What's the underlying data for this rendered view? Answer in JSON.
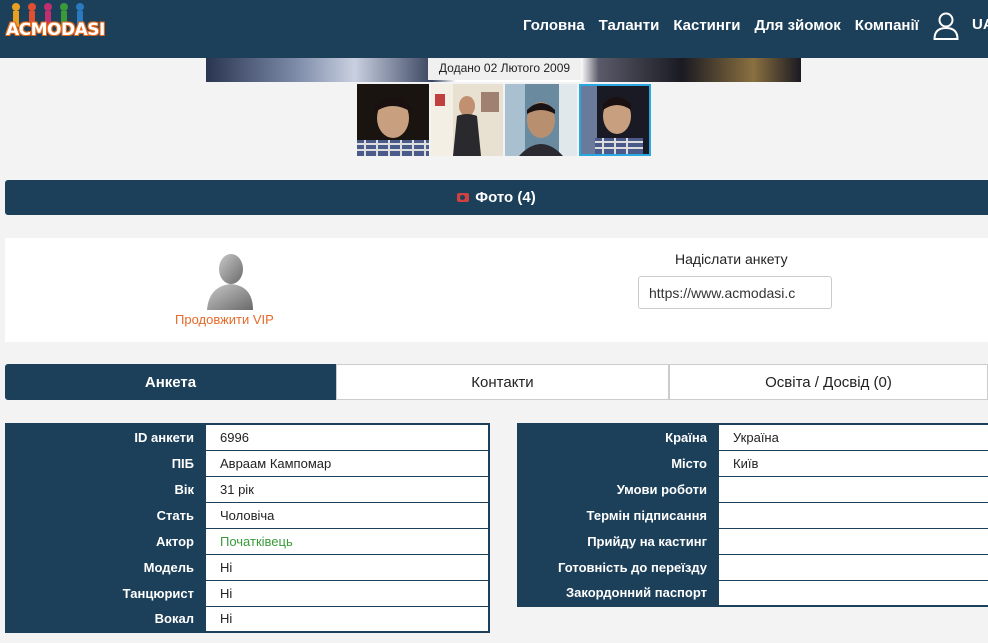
{
  "header": {
    "logo_text": "ACMODASI",
    "nav": [
      "Головна",
      "Таланти",
      "Кастинги",
      "Для зйомок",
      "Компанії"
    ],
    "lang": "UA"
  },
  "photo": {
    "caption": "Додано 02 Лютого 2009",
    "thumbnail_count": 4,
    "active_index": 3
  },
  "photo_bar": {
    "label": "Фото (4)",
    "icon": "camera-icon"
  },
  "panel": {
    "vip_label": "Продовжити VIP",
    "send_title": "Надіслати анкету",
    "send_value": "https://www.acmodasi.c"
  },
  "tabs": [
    {
      "label": "Анкета",
      "active": true
    },
    {
      "label": "Контакти",
      "active": false
    },
    {
      "label": "Освіта / Досвід (0)",
      "active": false
    }
  ],
  "left_table": [
    {
      "k": "ID анкети",
      "v": "6996"
    },
    {
      "k": "ПІБ",
      "v": "Авраам Кампомар"
    },
    {
      "k": "Вік",
      "v": "31 рік"
    },
    {
      "k": "Стать",
      "v": "Чоловіча"
    },
    {
      "k": "Актор",
      "v": "Початківець"
    },
    {
      "k": "Модель",
      "v": "Ні"
    },
    {
      "k": "Танцюрист",
      "v": "Ні"
    },
    {
      "k": "Вокал",
      "v": "Ні"
    }
  ],
  "right_table": [
    {
      "k": "Країна",
      "v": "Україна"
    },
    {
      "k": "Місто",
      "v": "Київ"
    },
    {
      "k": "Умови роботи",
      "v": ""
    },
    {
      "k": "Термін підписання",
      "v": ""
    },
    {
      "k": "Прийду на кастинг",
      "v": ""
    },
    {
      "k": "Готовність до переїзду",
      "v": ""
    },
    {
      "k": "Закордонний паспорт",
      "v": ""
    }
  ],
  "colors": {
    "primary": "#1c3f5a",
    "accent": "#e66a2a",
    "green": "#3a9a3a",
    "active_thumb": "#2aa6e0"
  }
}
